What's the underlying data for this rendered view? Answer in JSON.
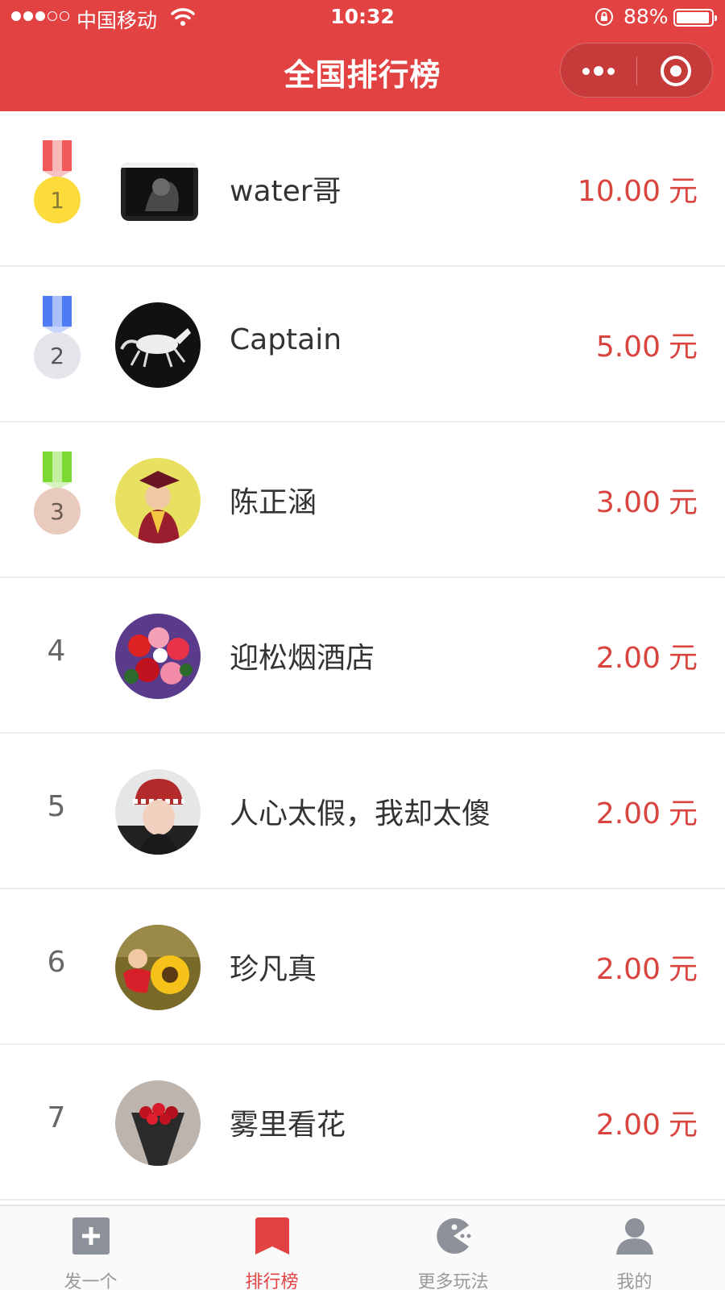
{
  "status_bar": {
    "carrier": "中国移动",
    "time": "10:32",
    "battery": "88%",
    "battery_level": 0.88
  },
  "nav": {
    "title": "全国排行榜"
  },
  "ranking": [
    {
      "rank": "1",
      "name": "water哥",
      "amount": "10.00",
      "unit": "元",
      "medal": "gold"
    },
    {
      "rank": "2",
      "name": "Captain",
      "amount": "5.00",
      "unit": "元",
      "medal": "silver"
    },
    {
      "rank": "3",
      "name": "陈正涵",
      "amount": "3.00",
      "unit": "元",
      "medal": "bronze"
    },
    {
      "rank": "4",
      "name": "迎松烟酒店",
      "amount": "2.00",
      "unit": "元"
    },
    {
      "rank": "5",
      "name": "人心太假，我却太傻",
      "amount": "2.00",
      "unit": "元"
    },
    {
      "rank": "6",
      "name": "珍凡真",
      "amount": "2.00",
      "unit": "元"
    },
    {
      "rank": "7",
      "name": "雾里看花",
      "amount": "2.00",
      "unit": "元"
    }
  ],
  "tabbar": {
    "items": [
      {
        "label": "发一个",
        "icon": "plus-square-icon"
      },
      {
        "label": "排行榜",
        "icon": "bookmark-icon",
        "active": true
      },
      {
        "label": "更多玩法",
        "icon": "pacman-icon"
      },
      {
        "label": "我的",
        "icon": "user-icon"
      }
    ]
  },
  "colors": {
    "brand": "#e24242",
    "amount": "#d9443f",
    "medal_gold": "#fddb3a",
    "medal_silver": "#e4e4ea",
    "medal_bronze": "#e8cbbd",
    "ribbon_1": "#f25a5a",
    "ribbon_2": "#4f7cf5",
    "ribbon_3": "#7cd832"
  }
}
